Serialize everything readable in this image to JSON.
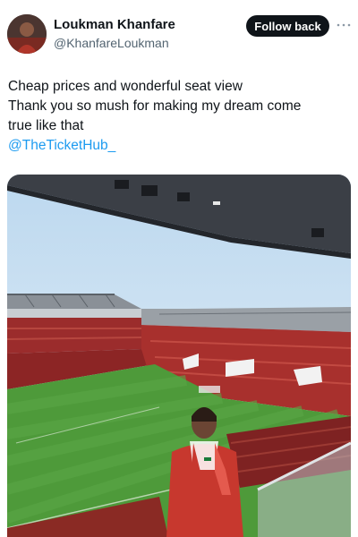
{
  "author": {
    "display_name": "Loukman Khanfare",
    "handle": "@KhanfareLoukman",
    "avatar_icon": "user-avatar"
  },
  "actions": {
    "follow_label": "Follow back",
    "more_icon": "more-horizontal-icon"
  },
  "tweet": {
    "lines": [
      "Cheap prices and wonderful seat view",
      "Thank you so mush for making my dream come",
      "true like that"
    ],
    "mention": "@TheTicketHub_"
  },
  "colors": {
    "text": "#0f1419",
    "secondary": "#536471",
    "link": "#1d9bf0",
    "button": "#0f1419"
  }
}
